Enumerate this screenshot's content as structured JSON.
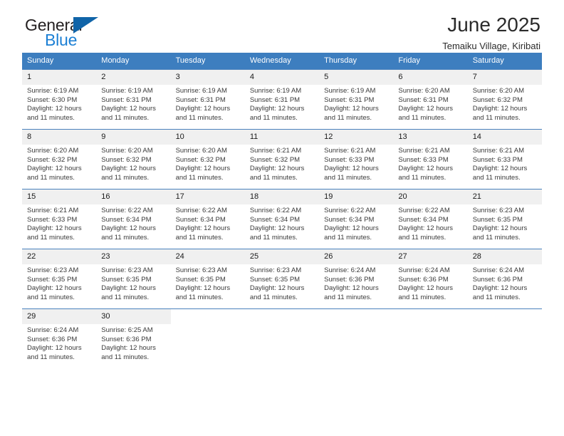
{
  "brand": {
    "name_top": "General",
    "name_bottom": "Blue",
    "triangle_icon": "triangle-logo-icon",
    "color_top": "#231f20",
    "color_bottom": "#1b7fd4",
    "triangle_color": "#1064a8"
  },
  "header": {
    "title": "June 2025",
    "subtitle": "Temaiku Village, Kiribati"
  },
  "theme": {
    "header_bg": "#3d7ebf",
    "header_text": "#ffffff",
    "daynum_bg": "#f0f0f0",
    "row_border": "#4a81bd",
    "page_bg": "#ffffff"
  },
  "calendar": {
    "weekdays": [
      "Sunday",
      "Monday",
      "Tuesday",
      "Wednesday",
      "Thursday",
      "Friday",
      "Saturday"
    ],
    "weeks": [
      [
        {
          "day": "1",
          "sunrise": "Sunrise: 6:19 AM",
          "sunset": "Sunset: 6:30 PM",
          "daylight_1": "Daylight: 12 hours",
          "daylight_2": "and 11 minutes."
        },
        {
          "day": "2",
          "sunrise": "Sunrise: 6:19 AM",
          "sunset": "Sunset: 6:31 PM",
          "daylight_1": "Daylight: 12 hours",
          "daylight_2": "and 11 minutes."
        },
        {
          "day": "3",
          "sunrise": "Sunrise: 6:19 AM",
          "sunset": "Sunset: 6:31 PM",
          "daylight_1": "Daylight: 12 hours",
          "daylight_2": "and 11 minutes."
        },
        {
          "day": "4",
          "sunrise": "Sunrise: 6:19 AM",
          "sunset": "Sunset: 6:31 PM",
          "daylight_1": "Daylight: 12 hours",
          "daylight_2": "and 11 minutes."
        },
        {
          "day": "5",
          "sunrise": "Sunrise: 6:19 AM",
          "sunset": "Sunset: 6:31 PM",
          "daylight_1": "Daylight: 12 hours",
          "daylight_2": "and 11 minutes."
        },
        {
          "day": "6",
          "sunrise": "Sunrise: 6:20 AM",
          "sunset": "Sunset: 6:31 PM",
          "daylight_1": "Daylight: 12 hours",
          "daylight_2": "and 11 minutes."
        },
        {
          "day": "7",
          "sunrise": "Sunrise: 6:20 AM",
          "sunset": "Sunset: 6:32 PM",
          "daylight_1": "Daylight: 12 hours",
          "daylight_2": "and 11 minutes."
        }
      ],
      [
        {
          "day": "8",
          "sunrise": "Sunrise: 6:20 AM",
          "sunset": "Sunset: 6:32 PM",
          "daylight_1": "Daylight: 12 hours",
          "daylight_2": "and 11 minutes."
        },
        {
          "day": "9",
          "sunrise": "Sunrise: 6:20 AM",
          "sunset": "Sunset: 6:32 PM",
          "daylight_1": "Daylight: 12 hours",
          "daylight_2": "and 11 minutes."
        },
        {
          "day": "10",
          "sunrise": "Sunrise: 6:20 AM",
          "sunset": "Sunset: 6:32 PM",
          "daylight_1": "Daylight: 12 hours",
          "daylight_2": "and 11 minutes."
        },
        {
          "day": "11",
          "sunrise": "Sunrise: 6:21 AM",
          "sunset": "Sunset: 6:32 PM",
          "daylight_1": "Daylight: 12 hours",
          "daylight_2": "and 11 minutes."
        },
        {
          "day": "12",
          "sunrise": "Sunrise: 6:21 AM",
          "sunset": "Sunset: 6:33 PM",
          "daylight_1": "Daylight: 12 hours",
          "daylight_2": "and 11 minutes."
        },
        {
          "day": "13",
          "sunrise": "Sunrise: 6:21 AM",
          "sunset": "Sunset: 6:33 PM",
          "daylight_1": "Daylight: 12 hours",
          "daylight_2": "and 11 minutes."
        },
        {
          "day": "14",
          "sunrise": "Sunrise: 6:21 AM",
          "sunset": "Sunset: 6:33 PM",
          "daylight_1": "Daylight: 12 hours",
          "daylight_2": "and 11 minutes."
        }
      ],
      [
        {
          "day": "15",
          "sunrise": "Sunrise: 6:21 AM",
          "sunset": "Sunset: 6:33 PM",
          "daylight_1": "Daylight: 12 hours",
          "daylight_2": "and 11 minutes."
        },
        {
          "day": "16",
          "sunrise": "Sunrise: 6:22 AM",
          "sunset": "Sunset: 6:34 PM",
          "daylight_1": "Daylight: 12 hours",
          "daylight_2": "and 11 minutes."
        },
        {
          "day": "17",
          "sunrise": "Sunrise: 6:22 AM",
          "sunset": "Sunset: 6:34 PM",
          "daylight_1": "Daylight: 12 hours",
          "daylight_2": "and 11 minutes."
        },
        {
          "day": "18",
          "sunrise": "Sunrise: 6:22 AM",
          "sunset": "Sunset: 6:34 PM",
          "daylight_1": "Daylight: 12 hours",
          "daylight_2": "and 11 minutes."
        },
        {
          "day": "19",
          "sunrise": "Sunrise: 6:22 AM",
          "sunset": "Sunset: 6:34 PM",
          "daylight_1": "Daylight: 12 hours",
          "daylight_2": "and 11 minutes."
        },
        {
          "day": "20",
          "sunrise": "Sunrise: 6:22 AM",
          "sunset": "Sunset: 6:34 PM",
          "daylight_1": "Daylight: 12 hours",
          "daylight_2": "and 11 minutes."
        },
        {
          "day": "21",
          "sunrise": "Sunrise: 6:23 AM",
          "sunset": "Sunset: 6:35 PM",
          "daylight_1": "Daylight: 12 hours",
          "daylight_2": "and 11 minutes."
        }
      ],
      [
        {
          "day": "22",
          "sunrise": "Sunrise: 6:23 AM",
          "sunset": "Sunset: 6:35 PM",
          "daylight_1": "Daylight: 12 hours",
          "daylight_2": "and 11 minutes."
        },
        {
          "day": "23",
          "sunrise": "Sunrise: 6:23 AM",
          "sunset": "Sunset: 6:35 PM",
          "daylight_1": "Daylight: 12 hours",
          "daylight_2": "and 11 minutes."
        },
        {
          "day": "24",
          "sunrise": "Sunrise: 6:23 AM",
          "sunset": "Sunset: 6:35 PM",
          "daylight_1": "Daylight: 12 hours",
          "daylight_2": "and 11 minutes."
        },
        {
          "day": "25",
          "sunrise": "Sunrise: 6:23 AM",
          "sunset": "Sunset: 6:35 PM",
          "daylight_1": "Daylight: 12 hours",
          "daylight_2": "and 11 minutes."
        },
        {
          "day": "26",
          "sunrise": "Sunrise: 6:24 AM",
          "sunset": "Sunset: 6:36 PM",
          "daylight_1": "Daylight: 12 hours",
          "daylight_2": "and 11 minutes."
        },
        {
          "day": "27",
          "sunrise": "Sunrise: 6:24 AM",
          "sunset": "Sunset: 6:36 PM",
          "daylight_1": "Daylight: 12 hours",
          "daylight_2": "and 11 minutes."
        },
        {
          "day": "28",
          "sunrise": "Sunrise: 6:24 AM",
          "sunset": "Sunset: 6:36 PM",
          "daylight_1": "Daylight: 12 hours",
          "daylight_2": "and 11 minutes."
        }
      ],
      [
        {
          "day": "29",
          "sunrise": "Sunrise: 6:24 AM",
          "sunset": "Sunset: 6:36 PM",
          "daylight_1": "Daylight: 12 hours",
          "daylight_2": "and 11 minutes."
        },
        {
          "day": "30",
          "sunrise": "Sunrise: 6:25 AM",
          "sunset": "Sunset: 6:36 PM",
          "daylight_1": "Daylight: 12 hours",
          "daylight_2": "and 11 minutes."
        },
        {
          "day": "",
          "sunrise": "",
          "sunset": "",
          "daylight_1": "",
          "daylight_2": ""
        },
        {
          "day": "",
          "sunrise": "",
          "sunset": "",
          "daylight_1": "",
          "daylight_2": ""
        },
        {
          "day": "",
          "sunrise": "",
          "sunset": "",
          "daylight_1": "",
          "daylight_2": ""
        },
        {
          "day": "",
          "sunrise": "",
          "sunset": "",
          "daylight_1": "",
          "daylight_2": ""
        },
        {
          "day": "",
          "sunrise": "",
          "sunset": "",
          "daylight_1": "",
          "daylight_2": ""
        }
      ]
    ]
  }
}
